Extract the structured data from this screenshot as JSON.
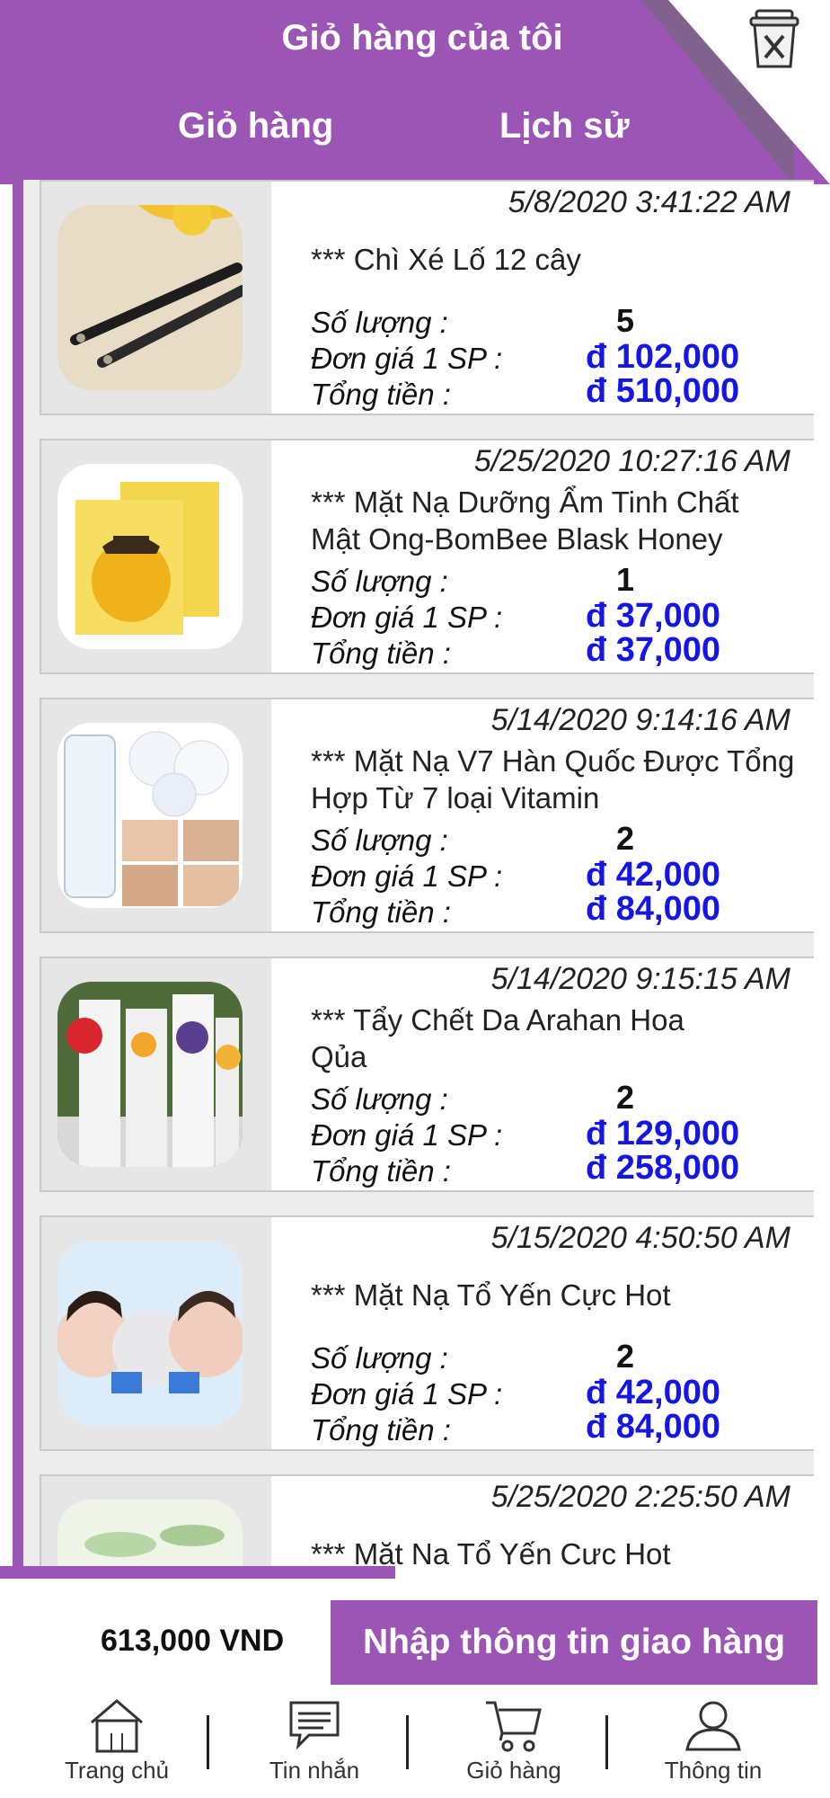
{
  "header": {
    "title": "Giỏ hàng của tôi",
    "tabs": [
      {
        "label": "Giỏ hàng"
      },
      {
        "label": "Lịch sử"
      }
    ]
  },
  "labels": {
    "quantity": "Số lượng :",
    "unit_price": "Đơn giá 1 SP :",
    "total": "Tổng tiền :"
  },
  "items": [
    {
      "date": "5/8/2020 3:41:22 AM",
      "name": "*** Chì Xé Lố 12 cây",
      "quantity": "5",
      "unit_price": "đ 102,000",
      "total": "đ 510,000"
    },
    {
      "date": "5/25/2020 10:27:16 AM",
      "name": "*** Mặt Nạ Dưỡng Ẩm Tinh Chất Mật Ong-BomBee Blask Honey",
      "quantity": "1",
      "unit_price": "đ 37,000",
      "total": "đ 37,000"
    },
    {
      "date": "5/14/2020 9:14:16 AM",
      "name": "*** Mặt Nạ V7 Hàn Quốc Được Tổng Hợp Từ 7 loại Vitamin",
      "quantity": "2",
      "unit_price": "đ 42,000",
      "total": "đ 84,000"
    },
    {
      "date": "5/14/2020 9:15:15 AM",
      "name": "*** Tẩy Chết Da Arahan Hoa Qủa",
      "quantity": "2",
      "unit_price": "đ 129,000",
      "total": "đ 258,000"
    },
    {
      "date": "5/15/2020 4:50:50 AM",
      "name": "*** Mặt Nạ Tổ Yến Cực Hot",
      "quantity": "2",
      "unit_price": "đ 42,000",
      "total": "đ 84,000"
    },
    {
      "date": "5/25/2020 2:25:50 AM",
      "name": "*** Mặt Nạ Tổ Yến Cực Hot"
    }
  ],
  "summary": {
    "total": "613,000 VND",
    "checkout_label": "Nhập thông tin giao hàng"
  },
  "nav": [
    {
      "label": "Trang chủ",
      "icon": "home-icon"
    },
    {
      "label": "Tin nhắn",
      "icon": "message-icon"
    },
    {
      "label": "Giỏ hàng",
      "icon": "cart-icon"
    },
    {
      "label": "Thông tin",
      "icon": "user-icon"
    }
  ],
  "colors": {
    "accent": "#9b55b5",
    "price": "#1515e6"
  }
}
